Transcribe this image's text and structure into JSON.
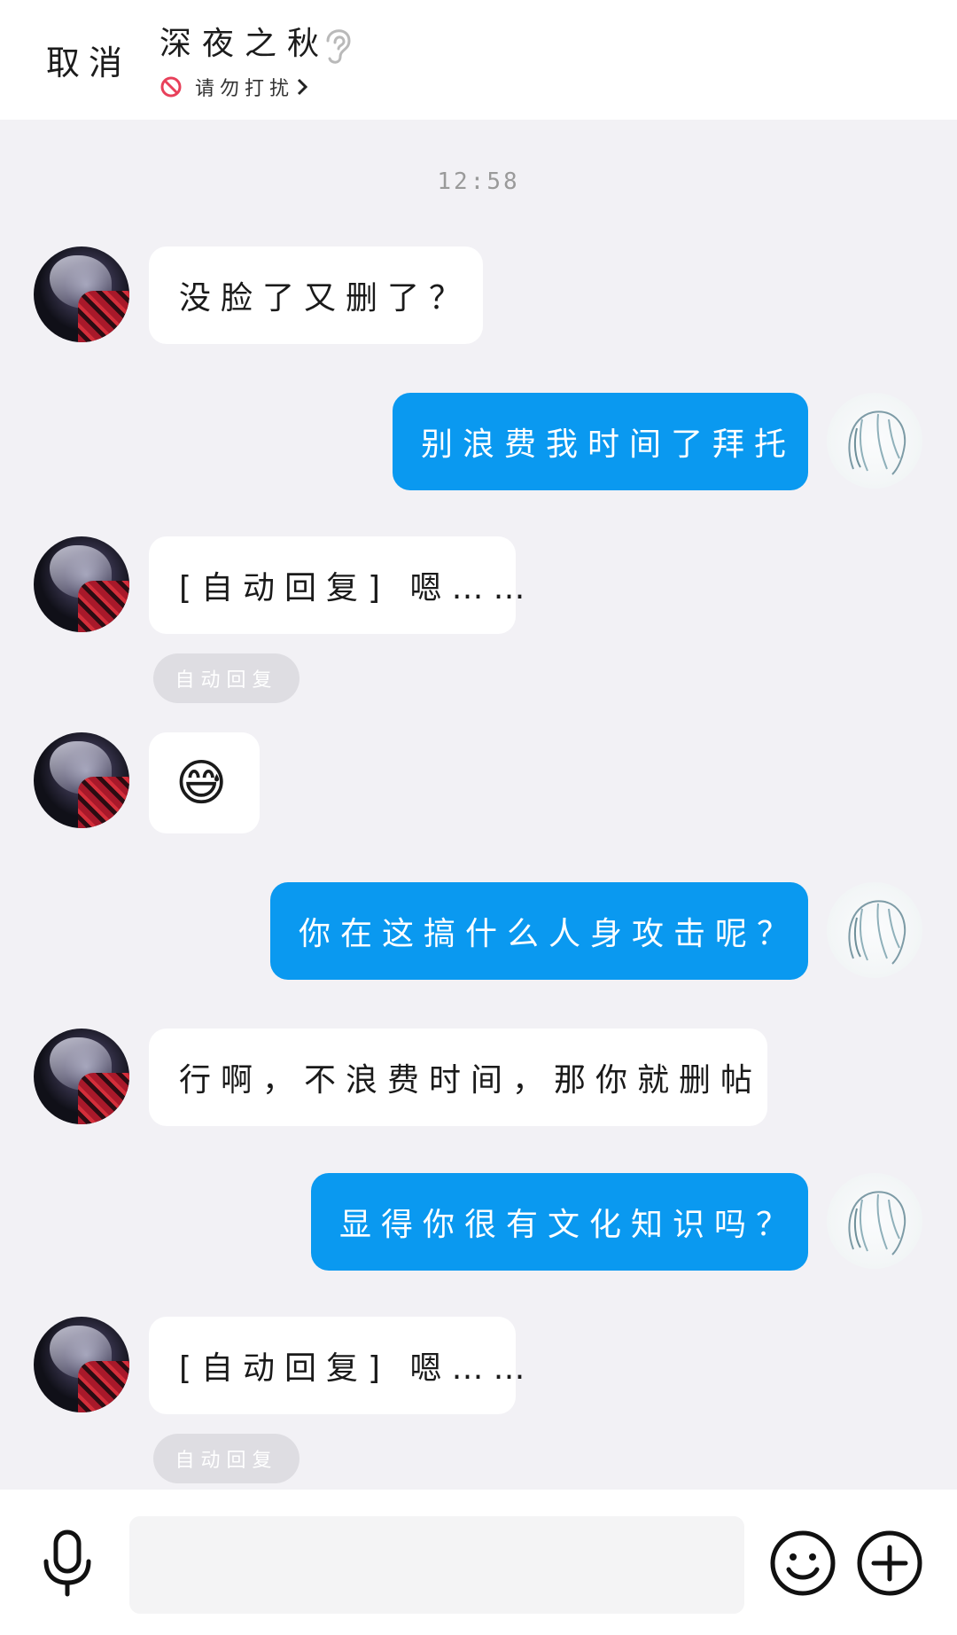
{
  "header": {
    "cancel_label": "取消",
    "title": "深夜之秋",
    "status_label": "请勿打扰"
  },
  "timestamp": "12:58",
  "messages": [
    {
      "side": "in",
      "text": "没脸了又删了？"
    },
    {
      "side": "out",
      "text": "别浪费我时间了拜托"
    },
    {
      "side": "in",
      "text": "[自动回复] 嗯……",
      "tag": "自动回复"
    },
    {
      "side": "in",
      "emoji": "😅"
    },
    {
      "side": "out",
      "text": "你在这搞什么人身攻击呢？"
    },
    {
      "side": "in",
      "text": "行啊，不浪费时间，那你就删帖"
    },
    {
      "side": "out",
      "text": "显得你很有文化知识吗？"
    },
    {
      "side": "in",
      "text": "[自动回复] 嗯……",
      "tag": "自动回复"
    }
  ],
  "input": {
    "value": "",
    "placeholder": ""
  },
  "icons": {
    "ear": "ear-icon",
    "dnd": "do-not-disturb-icon",
    "mic": "microphone-icon",
    "emoji": "smiley-icon",
    "plus": "plus-icon"
  },
  "colors": {
    "outgoing_bubble": "#0a99f0",
    "incoming_bubble": "#ffffff",
    "chat_background": "#f2f1f5",
    "dnd_icon": "#e8405a",
    "auto_tag": "#dedde2"
  }
}
